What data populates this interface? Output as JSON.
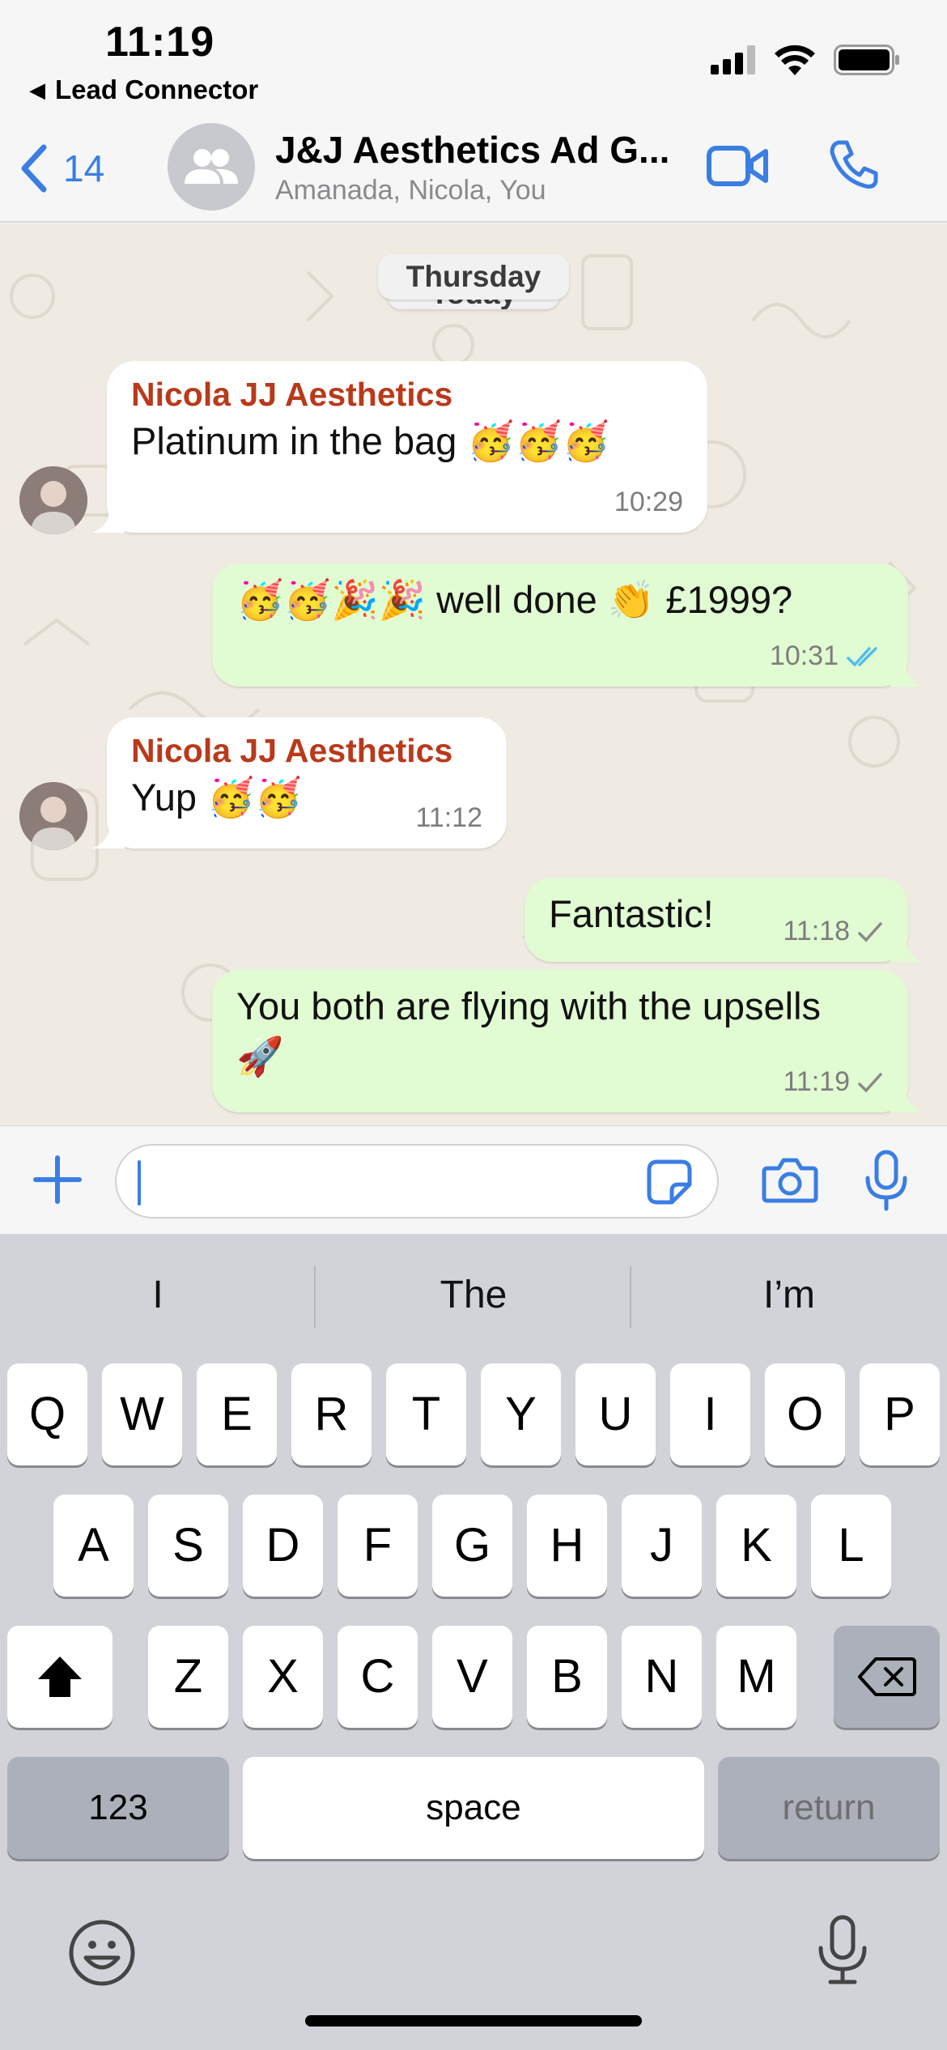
{
  "status_bar": {
    "time": "11:19",
    "back_app_label": "Lead Connector"
  },
  "header": {
    "back_count": "14",
    "title": "J&J Aesthetics Ad G...",
    "subtitle": "Amanada, Nicola, You",
    "icons": [
      "chevron-left-icon",
      "group-avatar-icon",
      "video-call-icon",
      "phone-icon"
    ]
  },
  "chat": {
    "date_chips": [
      "Thursday",
      "Today"
    ],
    "messages": [
      {
        "direction": "in",
        "sender": "Nicola JJ Aesthetics",
        "text": "Platinum in the bag 🥳🥳🥳",
        "time": "10:29"
      },
      {
        "direction": "out",
        "text": "🥳🥳🎉🎉 well done 👏 £1999?",
        "time": "10:31",
        "status": "read"
      },
      {
        "direction": "in",
        "sender": "Nicola JJ Aesthetics",
        "text": "Yup 🥳🥳",
        "time": "11:12"
      },
      {
        "direction": "out",
        "text": "Fantastic!",
        "time": "11:18",
        "status": "sent"
      },
      {
        "direction": "out",
        "text_line1": "You both are flying with the upsells",
        "text_line2": "🚀",
        "time": "11:19",
        "status": "sent"
      }
    ],
    "colors": {
      "sender_name": "#b83a1b",
      "outgoing_bubble": "#e1fbd2",
      "accent": "#3a7ee4",
      "read_ticks": "#53bdeb"
    }
  },
  "input": {
    "value": "",
    "icons": [
      "plus-icon",
      "sticker-icon",
      "camera-icon",
      "microphone-icon"
    ]
  },
  "keyboard": {
    "suggestions": [
      "I",
      "The",
      "I’m"
    ],
    "row1": [
      "Q",
      "W",
      "E",
      "R",
      "T",
      "Y",
      "U",
      "I",
      "O",
      "P"
    ],
    "row2": [
      "A",
      "S",
      "D",
      "F",
      "G",
      "H",
      "J",
      "K",
      "L"
    ],
    "row3": [
      "Z",
      "X",
      "C",
      "V",
      "B",
      "N",
      "M"
    ],
    "numbers_key": "123",
    "space_key": "space",
    "return_key": "return"
  }
}
